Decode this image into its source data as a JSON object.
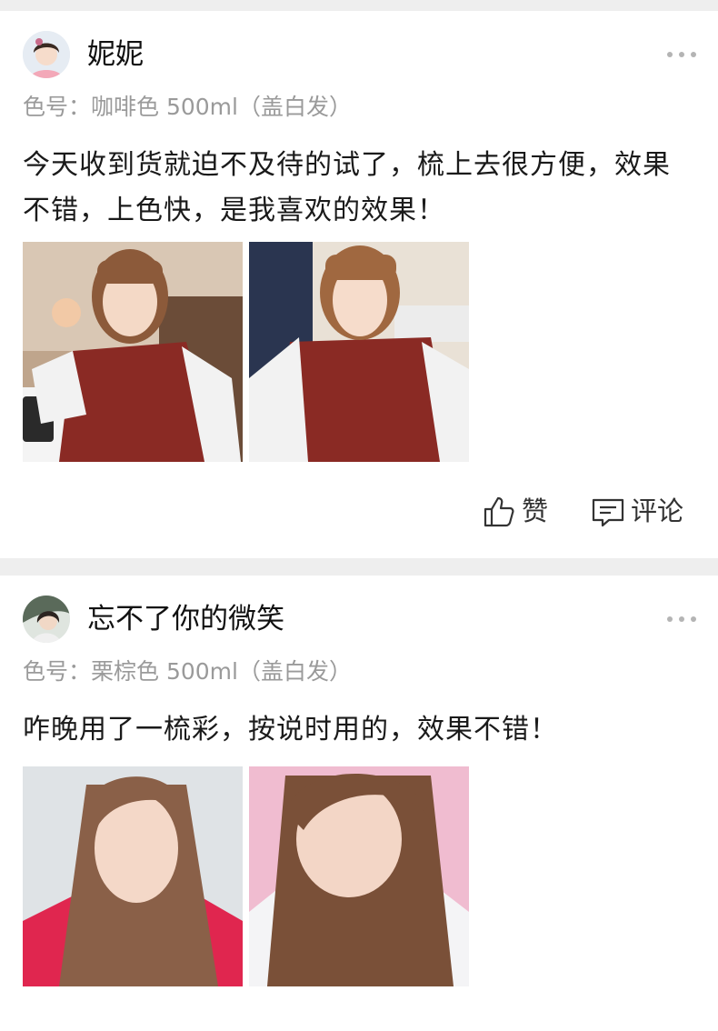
{
  "posts": [
    {
      "username": "妮妮",
      "variant": "色号：咖啡色 500ml（盖白发）",
      "text": "今天收到货就迫不及待的试了，梳上去很方便，效果不错，上色快，是我喜欢的效果！",
      "actions": {
        "like_label": "赞",
        "comment_label": "评论"
      }
    },
    {
      "username": "忘不了你的微笑",
      "variant": "色号：栗棕色 500ml（盖白发）",
      "text": "咋晚用了一梳彩，按说时用的，效果不错！"
    }
  ],
  "icons": {
    "more": "more-horizontal-icon",
    "like": "thumbs-up-icon",
    "comment": "comment-icon"
  },
  "colors": {
    "page_bg": "#eeeeee",
    "card_bg": "#ffffff",
    "meta_text": "#9a9a9a",
    "dots": "#b4b4b4"
  }
}
